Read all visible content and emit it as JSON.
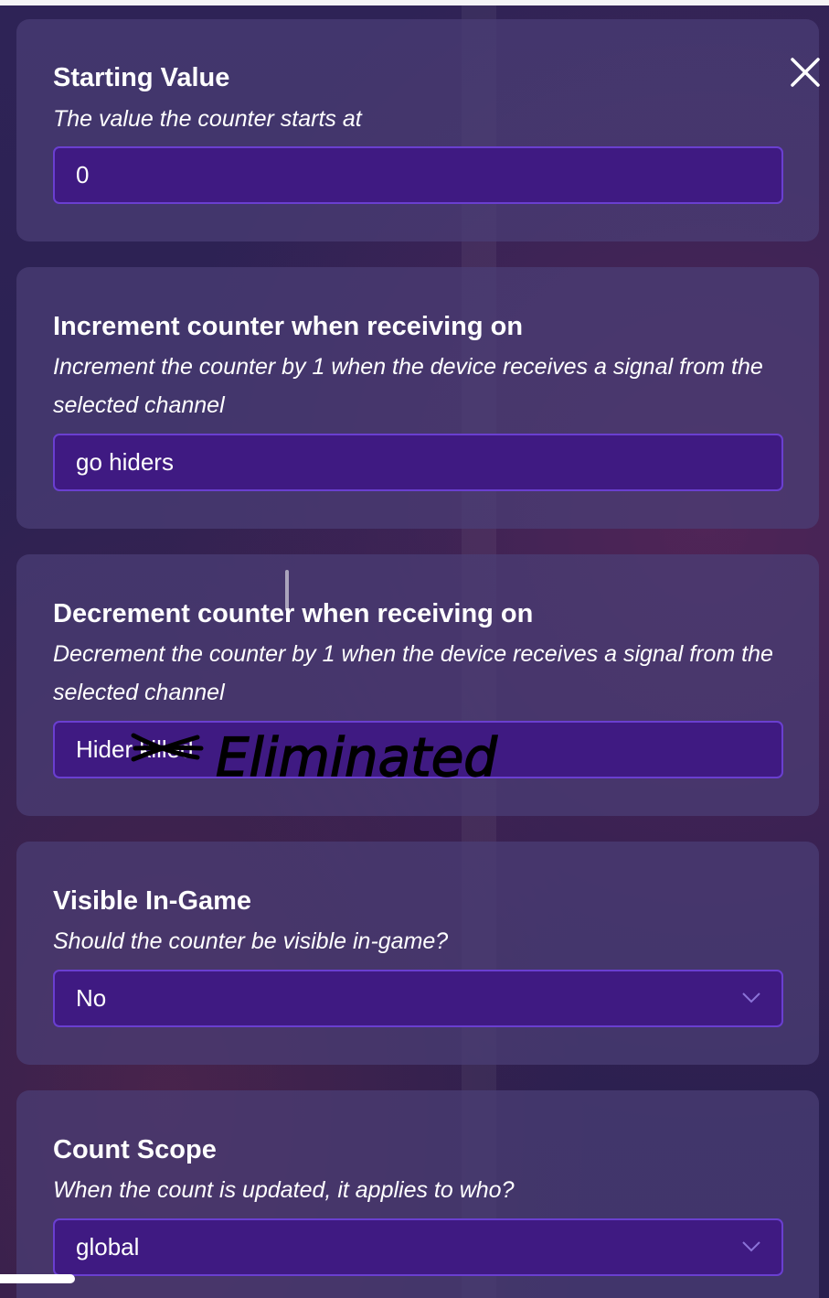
{
  "close_button": {
    "icon": "close-icon"
  },
  "panels": [
    {
      "title": "Starting Value",
      "description": "The value the counter starts at",
      "value": "0"
    },
    {
      "title": "Increment counter when receiving on",
      "description": "Increment the counter by 1 when the device receives a signal from the selected channel",
      "value": "go hiders"
    },
    {
      "title": "Decrement counter when receiving on",
      "description": "Decrement the counter by 1 when the device receives a signal from the selected channel",
      "value": "Hider killed",
      "handwritten_annotation": "Eliminated"
    },
    {
      "title": "Visible In-Game",
      "description": "Should the counter be visible in-game?",
      "value": "No",
      "icon": "chevron-down-icon"
    },
    {
      "title": "Count Scope",
      "description": "When the count is updated, it applies to who?",
      "value": "global",
      "icon": "chevron-down-icon"
    }
  ],
  "colors": {
    "background": "#2a1f52",
    "panel": "#4b3e76",
    "field_fill": "#3f1a82",
    "field_border": "#6a3fd0",
    "annotation_ink": "#000000"
  }
}
